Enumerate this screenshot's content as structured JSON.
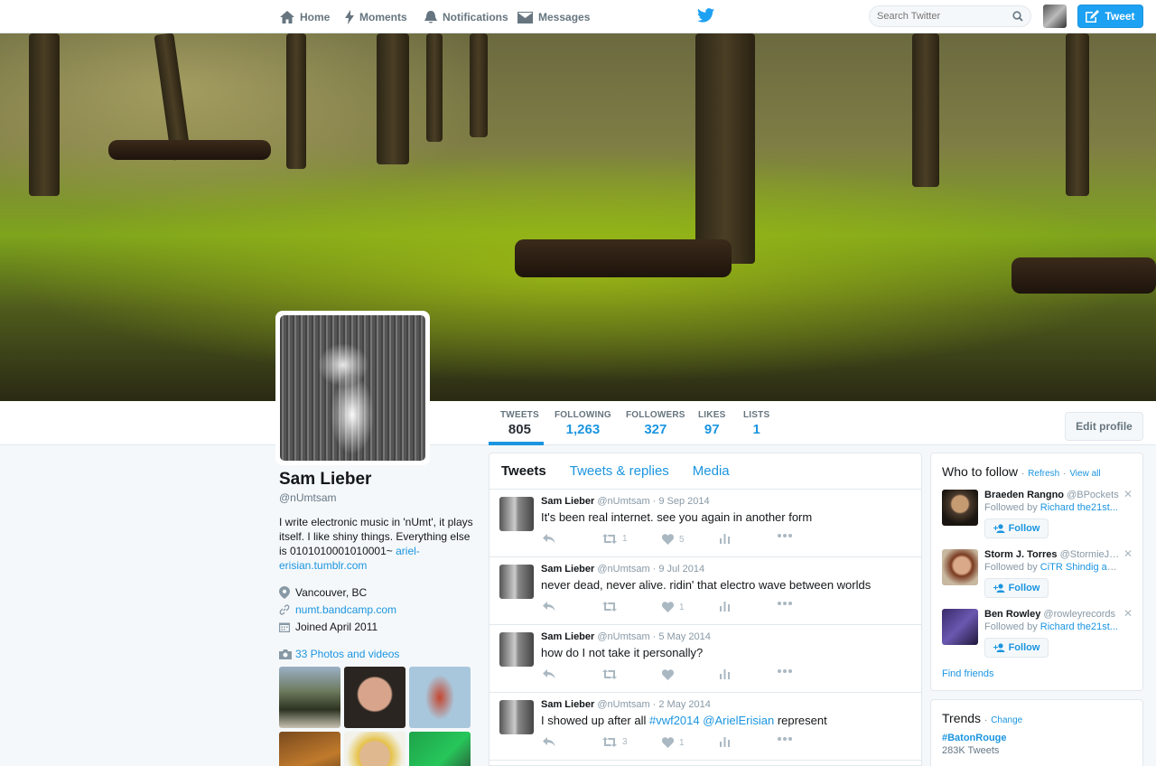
{
  "nav": {
    "home": "Home",
    "moments": "Moments",
    "notifications": "Notifications",
    "messages": "Messages",
    "search_placeholder": "Search Twitter",
    "tweet_button": "Tweet"
  },
  "colors": {
    "accent": "#1da1f2",
    "link": "#1b95e0",
    "text": "#14171a",
    "muted": "#657786"
  },
  "stats": [
    {
      "label": "TWEETS",
      "value": "805"
    },
    {
      "label": "FOLLOWING",
      "value": "1,263"
    },
    {
      "label": "FOLLOWERS",
      "value": "327"
    },
    {
      "label": "LIKES",
      "value": "97"
    },
    {
      "label": "LISTS",
      "value": "1"
    }
  ],
  "edit_profile": "Edit profile",
  "profile": {
    "name": "Sam Lieber",
    "handle": "@nUmtsam",
    "bio": "I write electronic music in 'nUmt', it plays itself. I like shiny things. Everything else is 0101010001010001~ ",
    "bio_link": "ariel-erisian.tumblr.com",
    "location": "Vancouver, BC",
    "website": "numt.bandcamp.com",
    "joined": "Joined April 2011",
    "photos_label": "33 Photos and videos"
  },
  "timeline": {
    "tabs": [
      "Tweets",
      "Tweets & replies",
      "Media"
    ],
    "tweets": [
      {
        "name": "Sam Lieber",
        "meta": "@nUmtsam · 9 Sep 2014",
        "text": "It's been real internet. see you again in another form",
        "retweets": "1",
        "likes": "5"
      },
      {
        "name": "Sam Lieber",
        "meta": "@nUmtsam · 9 Jul 2014",
        "text": "never dead, never alive. ridin' that electro wave between worlds",
        "retweets": "",
        "likes": "1"
      },
      {
        "name": "Sam Lieber",
        "meta": "@nUmtsam · 5 May 2014",
        "text": "how do I not take it personally?",
        "retweets": "",
        "likes": ""
      },
      {
        "name": "Sam Lieber",
        "meta": "@nUmtsam · 2 May 2014",
        "text_pre": "I showed up after all ",
        "hashtag": "#vwf2014",
        "mention": "@ArielErisian",
        "text_post": " represent",
        "retweets": "3",
        "likes": "1"
      }
    ]
  },
  "who_to_follow": {
    "title": "Who to follow",
    "refresh": "Refresh",
    "view_all": "View all",
    "follow_label": "Follow",
    "suggestions": [
      {
        "name": "Braeden Rangno",
        "handle": "@BPockets",
        "followed_prefix": "Followed by ",
        "followed_by": "Richard the21st..."
      },
      {
        "name": "Storm J. Torres",
        "handle": "@StormieJT...",
        "followed_prefix": "Followed by ",
        "followed_by": "CiTR Shindig an..."
      },
      {
        "name": "Ben Rowley",
        "handle": "@rowleyrecords",
        "followed_prefix": "Followed by ",
        "followed_by": "Richard the21st..."
      }
    ],
    "find_friends": "Find friends"
  },
  "trends": {
    "title": "Trends",
    "change": "Change",
    "items": [
      {
        "tag": "#BatonRouge",
        "count": "283K Tweets"
      }
    ]
  }
}
